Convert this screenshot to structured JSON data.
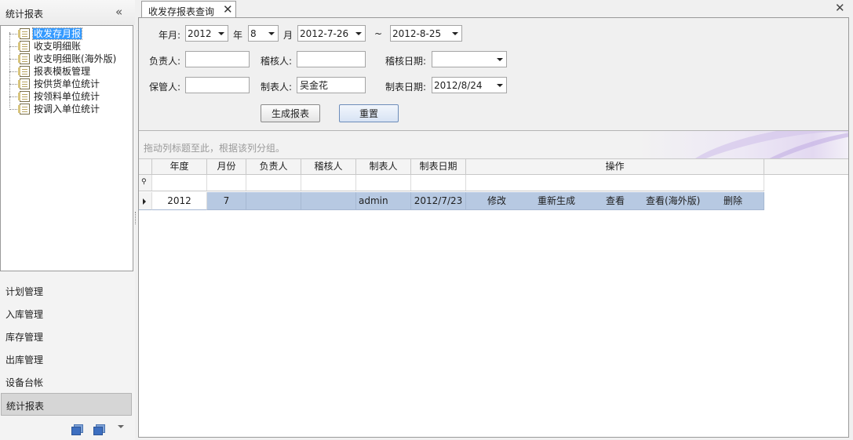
{
  "nav": {
    "title": "统计报表",
    "collapse_glyph": "«",
    "tree": [
      {
        "label": "收发存月报",
        "selected": true
      },
      {
        "label": "收支明细账"
      },
      {
        "label": "收支明细账(海外版)"
      },
      {
        "label": "报表模板管理"
      },
      {
        "label": "按供货单位统计"
      },
      {
        "label": "按领料单位统计"
      },
      {
        "label": "按调入单位统计"
      }
    ],
    "groups": [
      "计划管理",
      "入库管理",
      "库存管理",
      "出库管理",
      "设备台帐",
      "统计报表"
    ],
    "active_group": "统计报表"
  },
  "tab": {
    "label": "收发存报表查询",
    "close_glyph": "✕"
  },
  "window_close_glyph": "✕",
  "filter": {
    "year_month_label": "年月:",
    "year": "2012",
    "year_unit": "年",
    "month": "8",
    "month_unit": "月",
    "date_from": "2012-7-26",
    "range_sep": "~",
    "date_to": "2012-8-25",
    "owner_label": "负责人:",
    "owner_value": "",
    "auditor_label": "稽核人:",
    "auditor_value": "",
    "audit_date_label": "稽核日期:",
    "audit_date_value": "",
    "keeper_label": "保管人:",
    "keeper_value": "",
    "maker_label": "制表人:",
    "maker_value": "吴金花",
    "make_date_label": "制表日期:",
    "make_date_value": "2012/8/24",
    "generate_button": "生成报表",
    "reset_button": "重置"
  },
  "grid": {
    "group_hint": "拖动列标题至此，根据该列分组。",
    "columns": [
      "年度",
      "月份",
      "负责人",
      "稽核人",
      "制表人",
      "制表日期",
      "操作"
    ],
    "rows": [
      {
        "year": "2012",
        "month": "7",
        "owner": "",
        "auditor": "",
        "maker": "admin",
        "make_date": "2012/7/23"
      }
    ],
    "actions": [
      "修改",
      "重新生成",
      "查看",
      "查看(海外版)",
      "删除"
    ]
  }
}
